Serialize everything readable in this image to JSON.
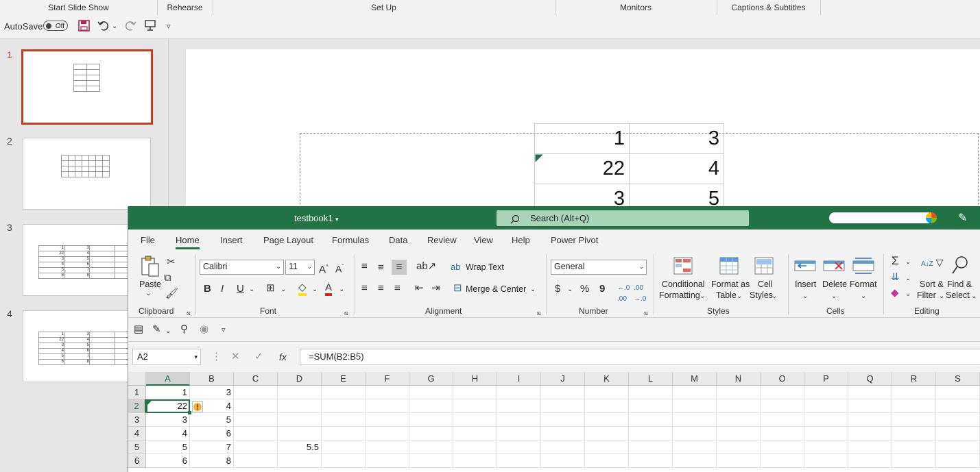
{
  "powerpoint": {
    "ribbon_groups": [
      "Start Slide Show",
      "Rehearse",
      "Set Up",
      "Monitors",
      "Captions & Subtitles"
    ],
    "autosave_label": "AutoSave",
    "autosave_state": "Off",
    "slide_numbers": [
      "1",
      "2",
      "3",
      "4"
    ],
    "thumb_rows": [
      [
        "1",
        "3"
      ],
      [
        "22",
        "4"
      ],
      [
        "3",
        "5"
      ],
      [
        "4",
        "6"
      ],
      [
        "5",
        "7"
      ],
      [
        "6",
        "8"
      ]
    ],
    "slide_table": [
      [
        "1",
        "3"
      ],
      [
        "22",
        "4"
      ],
      [
        "3",
        "5"
      ]
    ],
    "selected_slide_color": "#c43e1c"
  },
  "excel": {
    "doc_title": "testbook1",
    "search_placeholder": "Search (Alt+Q)",
    "title_bar_color": "#217346",
    "tabs": [
      "File",
      "Home",
      "Insert",
      "Page Layout",
      "Formulas",
      "Data",
      "Review",
      "View",
      "Help",
      "Power Pivot"
    ],
    "active_tab": "Home",
    "ribbon": {
      "paste": "Paste",
      "clipboard": "Clipboard",
      "font_name": "Calibri",
      "font_size": "11",
      "font": "Font",
      "bold": "B",
      "italic": "I",
      "underline": "U",
      "wrap_text": "Wrap Text",
      "merge_center": "Merge & Center",
      "alignment": "Alignment",
      "number_format": "General",
      "currency": "$",
      "percent": "%",
      "comma": "9",
      "number": "Number",
      "conditional_formatting_1": "Conditional",
      "conditional_formatting_2": "Formatting",
      "format_as_table_1": "Format as",
      "format_as_table_2": "Table",
      "cell_styles_1": "Cell",
      "cell_styles_2": "Styles",
      "styles": "Styles",
      "insert": "Insert",
      "delete": "Delete",
      "format": "Format",
      "cells": "Cells",
      "sort_filter_1": "Sort &",
      "sort_filter_2": "Filter",
      "find_select_1": "Find &",
      "find_select_2": "Select",
      "editing": "Editing"
    },
    "name_box": "A2",
    "fx": "fx",
    "formula": "=SUM(B2:B5)",
    "columns": [
      "A",
      "B",
      "C",
      "D",
      "E",
      "F",
      "G",
      "H",
      "I",
      "J",
      "K",
      "L",
      "M",
      "N",
      "O",
      "P",
      "Q",
      "R",
      "S"
    ],
    "rows": [
      "1",
      "2",
      "3",
      "4",
      "5",
      "6"
    ],
    "cells": {
      "A1": "1",
      "B1": "3",
      "A2": "22",
      "B2": "4",
      "A3": "3",
      "B3": "5",
      "A4": "4",
      "B4": "6",
      "A5": "5",
      "B5": "7",
      "D5": "5.5",
      "A6": "6",
      "B6": "8"
    },
    "active_cell": "A2"
  }
}
